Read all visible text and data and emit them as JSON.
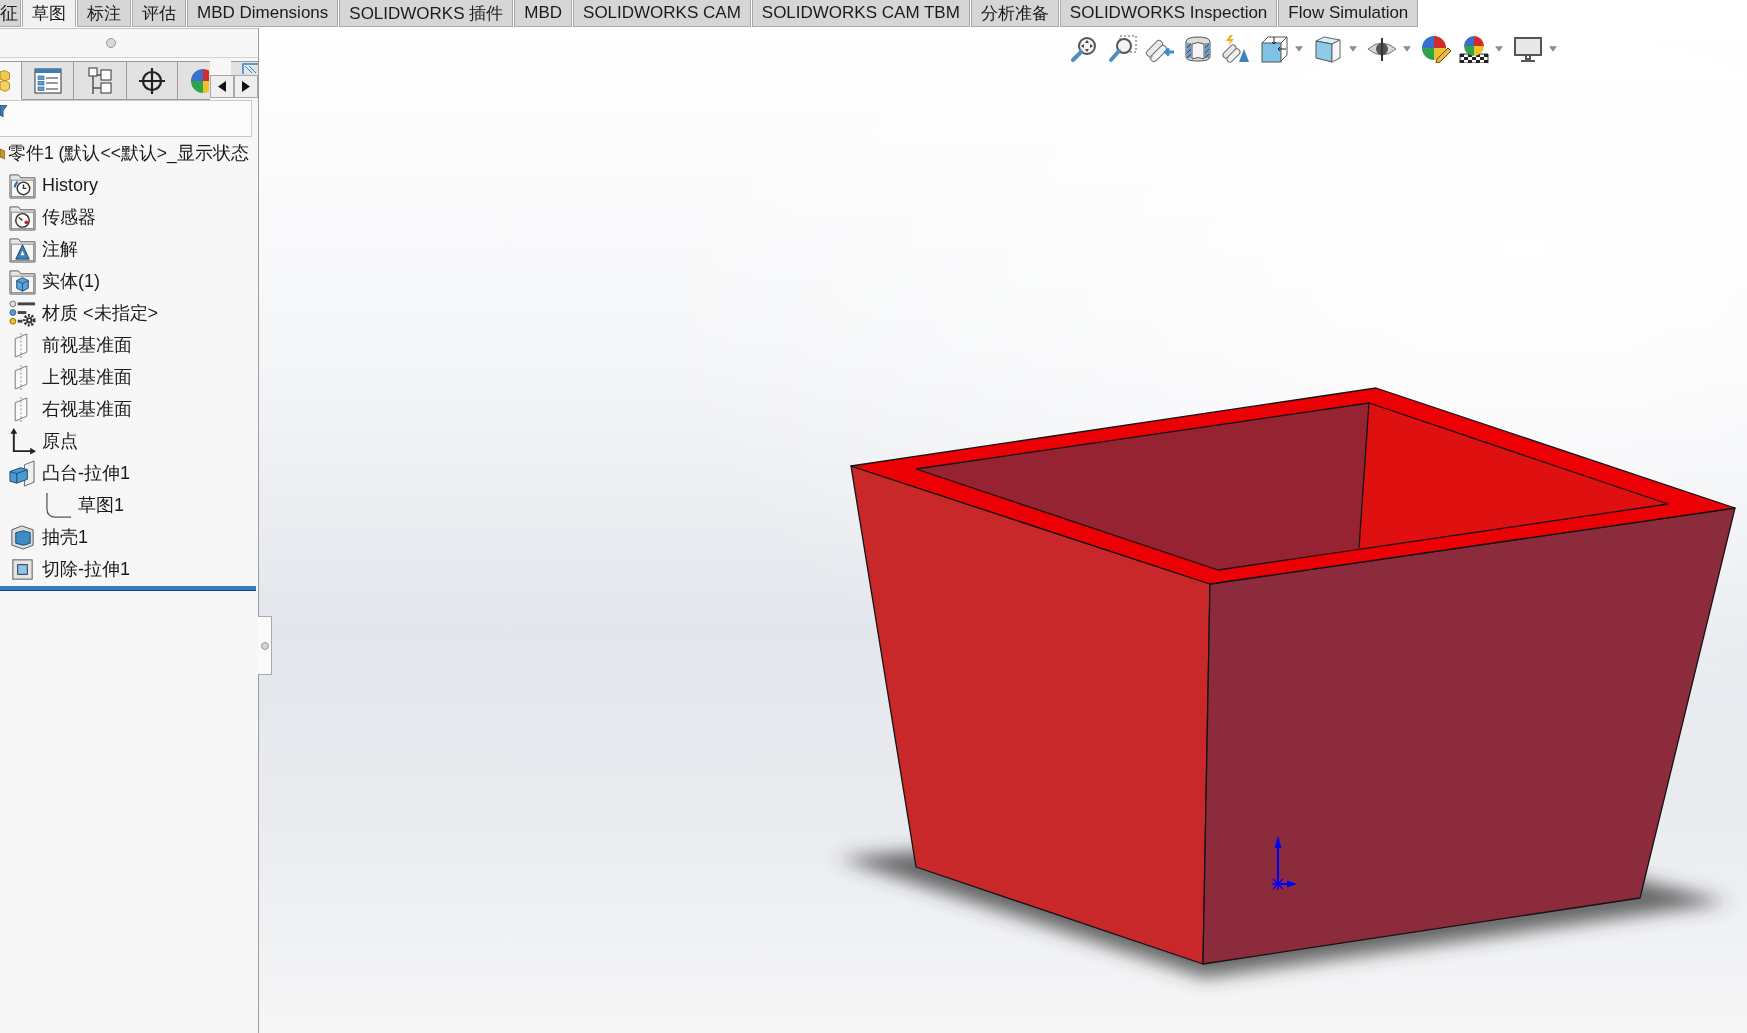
{
  "tabs": [
    {
      "label": "征",
      "selected": false
    },
    {
      "label": "草图",
      "selected": true
    },
    {
      "label": "标注",
      "selected": false
    },
    {
      "label": "评估",
      "selected": false
    },
    {
      "label": "MBD Dimensions",
      "selected": false
    },
    {
      "label": "SOLIDWORKS 插件",
      "selected": false
    },
    {
      "label": "MBD",
      "selected": false
    },
    {
      "label": "SOLIDWORKS CAM",
      "selected": false
    },
    {
      "label": "SOLIDWORKS CAM TBM",
      "selected": false
    },
    {
      "label": "分析准备",
      "selected": false
    },
    {
      "label": "SOLIDWORKS Inspection",
      "selected": false
    },
    {
      "label": "Flow Simulation",
      "selected": false
    }
  ],
  "feature_manager": {
    "panel_tabs": [
      {
        "selected": true
      },
      {
        "selected": false
      },
      {
        "selected": false
      },
      {
        "selected": false
      },
      {
        "selected": false
      },
      {
        "selected": false
      }
    ],
    "root": {
      "label": "零件1 (默认<<默认>_显示状态"
    },
    "items": [
      {
        "kind": "history",
        "label": "History"
      },
      {
        "kind": "sensors",
        "label": "传感器"
      },
      {
        "kind": "annotations",
        "label": "注解"
      },
      {
        "kind": "solid_bodies",
        "label": "实体(1)"
      },
      {
        "kind": "material",
        "label": "材质 <未指定>"
      },
      {
        "kind": "plane",
        "label": "前视基准面"
      },
      {
        "kind": "plane",
        "label": "上视基准面"
      },
      {
        "kind": "plane",
        "label": "右视基准面"
      },
      {
        "kind": "origin",
        "label": "原点"
      },
      {
        "kind": "boss_extrude",
        "label": "凸台-拉伸1",
        "children": [
          {
            "kind": "sketch",
            "label": "草图1"
          }
        ]
      },
      {
        "kind": "shell",
        "label": "抽壳1"
      },
      {
        "kind": "cut_extrude",
        "label": "切除-拉伸1"
      }
    ]
  }
}
